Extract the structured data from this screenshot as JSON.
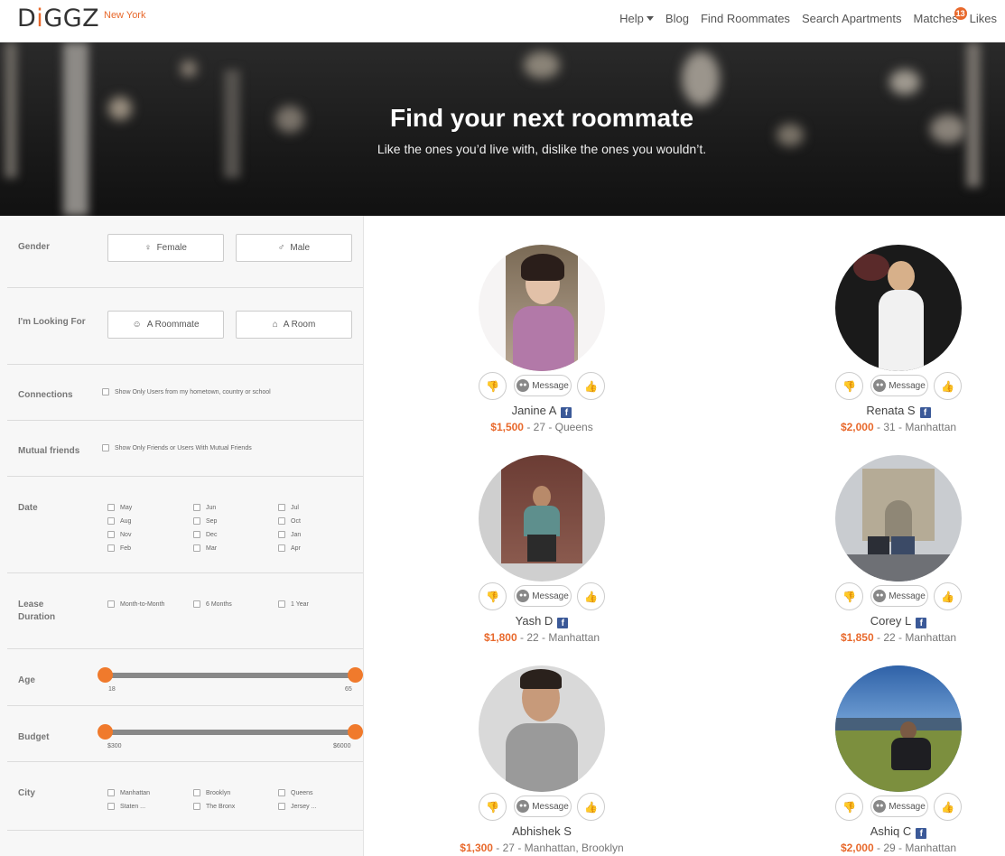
{
  "header": {
    "logo": "DiGGZ",
    "city": "New York",
    "nav": {
      "help": "Help",
      "blog": "Blog",
      "find_roommates": "Find Roommates",
      "search_apartments": "Search Apartments",
      "matches": "Matches",
      "matches_count": "13",
      "likes": "Likes"
    }
  },
  "hero": {
    "title": "Find your next roommate",
    "subtitle": "Like the ones you’d live with, dislike the ones you wouldn’t."
  },
  "filters": {
    "gender": {
      "label": "Gender",
      "female": "Female",
      "male": "Male"
    },
    "looking_for": {
      "label": "I'm Looking For",
      "roommate": "A Roommate",
      "room": "A Room"
    },
    "connections": {
      "label": "Connections",
      "option": "Show Only Users from my hometown, country or school"
    },
    "mutual_friends": {
      "label": "Mutual friends",
      "option": "Show Only Friends or Users With Mutual Friends"
    },
    "date": {
      "label": "Date",
      "months": [
        "May",
        "Jun",
        "Jul",
        "Aug",
        "Sep",
        "Oct",
        "Nov",
        "Dec",
        "Jan",
        "Feb",
        "Mar",
        "Apr"
      ]
    },
    "lease": {
      "label": "Lease Duration",
      "options": [
        "Month-to-Month",
        "6 Months",
        "1 Year"
      ]
    },
    "age": {
      "label": "Age",
      "min": "18",
      "max": "65"
    },
    "budget": {
      "label": "Budget",
      "min": "$300",
      "max": "$6000"
    },
    "city": {
      "label": "City",
      "options": [
        "Manhattan",
        "Brooklyn",
        "Queens",
        "Staten ...",
        "The Bronx",
        "Jersey ..."
      ]
    }
  },
  "message_label": "Message",
  "profiles": [
    {
      "name": "Janine A",
      "facebook": true,
      "price": "$1,500",
      "meta": " - 27 - Queens"
    },
    {
      "name": "Renata S",
      "facebook": true,
      "price": "$2,000",
      "meta": " - 31 - Manhattan"
    },
    {
      "name": "Yash D",
      "facebook": true,
      "price": "$1,800",
      "meta": " - 22 - Manhattan"
    },
    {
      "name": "Corey L",
      "facebook": true,
      "price": "$1,850",
      "meta": " - 22 - Manhattan"
    },
    {
      "name": "Abhishek S",
      "facebook": false,
      "price": "$1,300",
      "meta": " - 27 - Manhattan, Brooklyn"
    },
    {
      "name": "Ashiq C",
      "facebook": true,
      "price": "$2,000",
      "meta": " - 29 - Manhattan"
    }
  ],
  "colors": {
    "accent": "#e8692c",
    "facebook": "#3b5998"
  }
}
